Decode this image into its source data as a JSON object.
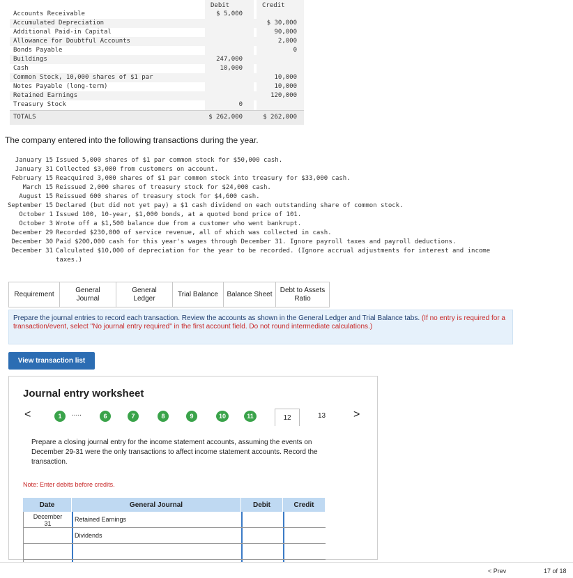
{
  "trial_balance": {
    "debit_header": "Debit",
    "credit_header": "Credit",
    "rows": [
      {
        "name": "Accounts Receivable",
        "debit": "$ 5,000",
        "credit": ""
      },
      {
        "name": "Accumulated Depreciation",
        "debit": "",
        "credit": "$ 30,000"
      },
      {
        "name": "Additional Paid-in Capital",
        "debit": "",
        "credit": "90,000"
      },
      {
        "name": "Allowance for Doubtful Accounts",
        "debit": "",
        "credit": "2,000"
      },
      {
        "name": "Bonds Payable",
        "debit": "",
        "credit": "0"
      },
      {
        "name": "Buildings",
        "debit": "247,000",
        "credit": ""
      },
      {
        "name": "Cash",
        "debit": "10,000",
        "credit": ""
      },
      {
        "name": "Common Stock, 10,000 shares of $1 par",
        "debit": "",
        "credit": "10,000"
      },
      {
        "name": "Notes Payable (long-term)",
        "debit": "",
        "credit": "10,000"
      },
      {
        "name": "Retained Earnings",
        "debit": "",
        "credit": "120,000"
      },
      {
        "name": "Treasury Stock",
        "debit": "0",
        "credit": ""
      }
    ],
    "totals_label": "TOTALS",
    "total_debit": "$ 262,000",
    "total_credit": "$ 262,000"
  },
  "intro_text": "The company entered into the following transactions during the year.",
  "transactions": [
    {
      "date": "January 15",
      "text": "Issued 5,000 shares of $1 par common stock for $50,000 cash."
    },
    {
      "date": "January 31",
      "text": "Collected $3,000 from customers on account."
    },
    {
      "date": "February 15",
      "text": "Reacquired 3,000 shares of $1 par common stock into treasury for $33,000 cash."
    },
    {
      "date": "March 15",
      "text": "Reissued 2,000 shares of treasury stock for $24,000 cash."
    },
    {
      "date": "August 15",
      "text": "Reissued 600 shares of treasury stock for $4,600 cash."
    },
    {
      "date": "September 15",
      "text": "Declared (but did not yet pay) a $1 cash dividend on each outstanding share of common stock."
    },
    {
      "date": "October 1",
      "text": "Issued 100, 10-year, $1,000 bonds, at a quoted bond price of 101."
    },
    {
      "date": "October 3",
      "text": "Wrote off a $1,500 balance due from a customer who went bankrupt."
    },
    {
      "date": "December 29",
      "text": "Recorded $230,000 of service revenue, all of which was collected in cash."
    },
    {
      "date": "December 30",
      "text": "Paid $200,000 cash for this year's wages through December 31. Ignore payroll taxes and payroll deductions."
    },
    {
      "date": "December 31",
      "text": "Calculated $10,000 of depreciation for the year to be recorded. (Ignore accrual adjustments for interest and income"
    },
    {
      "date": "",
      "text": "taxes.)"
    }
  ],
  "tabs": [
    {
      "label": "Requirement"
    },
    {
      "label": "General\nJournal"
    },
    {
      "label": "General\nLedger"
    },
    {
      "label": "Trial Balance"
    },
    {
      "label": "Balance Sheet"
    },
    {
      "label": "Debt to Assets\nRatio"
    }
  ],
  "instruction": {
    "main": "Prepare the journal entries to record each transaction. Review the accounts as shown in the General Ledger and Trial Balance tabs.",
    "note": "(If no entry is required for a transaction/event, select \"No journal entry required\" in the first account field. Do not round intermediate calculations.)"
  },
  "view_button": "View transaction list",
  "worksheet": {
    "title": "Journal entry worksheet",
    "nav": {
      "prev": "<",
      "next": ">",
      "first": "1",
      "ellipsis": ".....",
      "items": [
        "6",
        "7",
        "8",
        "9",
        "10",
        "11"
      ],
      "current": "12",
      "after": "13"
    },
    "prompt": "Prepare a closing journal entry for the income statement accounts, assuming the events on December 29-31 were the only transactions to affect income statement accounts. Record the transaction.",
    "note": "Note: Enter debits before credits.",
    "table": {
      "headers": [
        "Date",
        "General Journal",
        "Debit",
        "Credit"
      ],
      "rows": [
        {
          "date": "December\n31",
          "account": "Retained Earnings",
          "debit": "",
          "credit": ""
        },
        {
          "date": "",
          "account": "Dividends",
          "debit": "",
          "credit": ""
        },
        {
          "date": "",
          "account": "",
          "debit": "",
          "credit": ""
        },
        {
          "date": "",
          "account": "",
          "debit": "",
          "credit": ""
        }
      ]
    }
  },
  "footer": {
    "prev": "< Prev",
    "page": "17 of 18"
  }
}
